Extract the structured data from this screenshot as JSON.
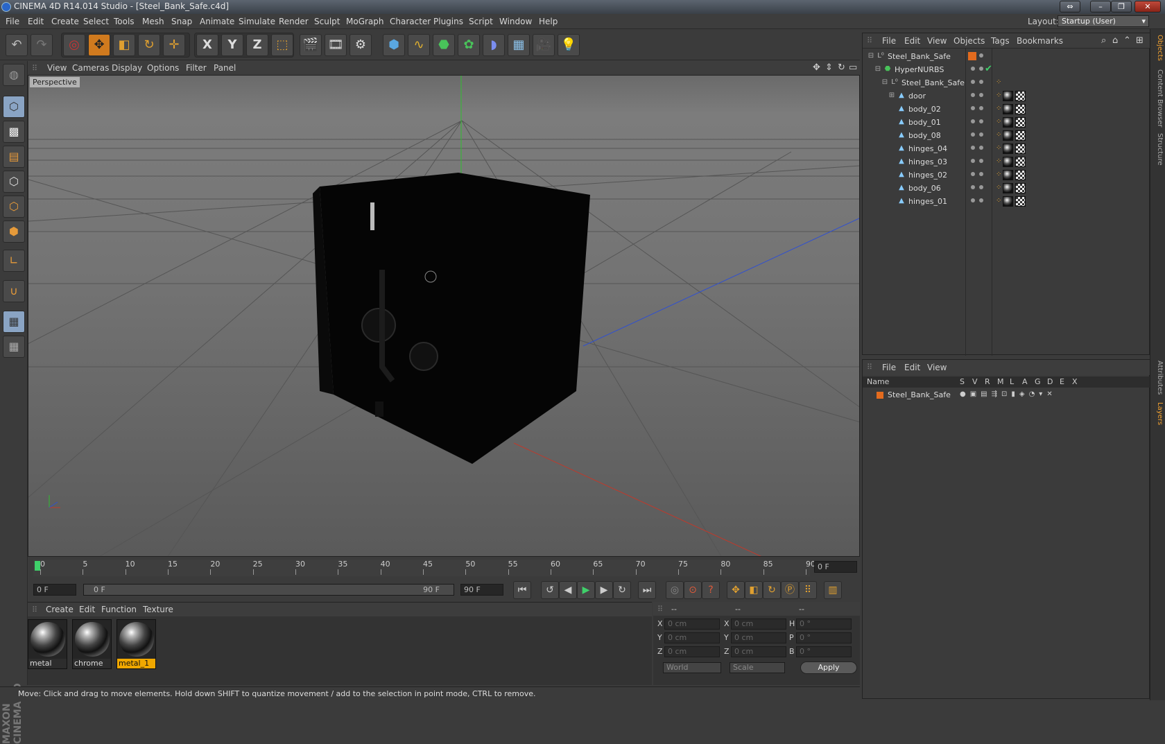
{
  "window": {
    "title": "CINEMA 4D R14.014 Studio - [Steel_Bank_Safe.c4d]"
  },
  "menubar": {
    "items": [
      "File",
      "Edit",
      "Create",
      "Select",
      "Tools",
      "Mesh",
      "Snap",
      "Animate",
      "Simulate",
      "Render",
      "Sculpt",
      "MoGraph",
      "Character",
      "Plugins",
      "Script",
      "Window",
      "Help"
    ],
    "layout_label": "Layout:",
    "layout_value": "Startup (User)"
  },
  "toolbar": {
    "x_label": "X",
    "y_label": "Y",
    "z_label": "Z"
  },
  "viewport": {
    "menu": [
      "View",
      "Cameras",
      "Display",
      "Options",
      "Filter",
      "Panel"
    ],
    "label": "Perspective"
  },
  "timeline": {
    "ticks": [
      "0",
      "5",
      "10",
      "15",
      "20",
      "25",
      "30",
      "35",
      "40",
      "45",
      "50",
      "55",
      "60",
      "65",
      "70",
      "75",
      "80",
      "85",
      "90"
    ],
    "current_frame": "0 F"
  },
  "transport": {
    "start": "0 F",
    "range_start": "0 F",
    "range_end": "90 F",
    "end": "90 F"
  },
  "material_panel": {
    "menu": [
      "Create",
      "Edit",
      "Function",
      "Texture"
    ],
    "materials": [
      "metal",
      "chrome",
      "metal_1"
    ]
  },
  "coords": {
    "headers": [
      "--",
      "--",
      "--"
    ],
    "rows": [
      {
        "a": "X",
        "av": "0 cm",
        "b": "X",
        "bv": "0 cm",
        "c": "H",
        "cv": "0 °"
      },
      {
        "a": "Y",
        "av": "0 cm",
        "b": "Y",
        "bv": "0 cm",
        "c": "P",
        "cv": "0 °"
      },
      {
        "a": "Z",
        "av": "0 cm",
        "b": "Z",
        "bv": "0 cm",
        "c": "B",
        "cv": "0 °"
      }
    ],
    "world": "World",
    "scale": "Scale",
    "apply": "Apply"
  },
  "status": "Move: Click and drag to move elements. Hold down SHIFT to quantize movement / add to the selection in point mode, CTRL to remove.",
  "object_manager": {
    "menu": [
      "File",
      "Edit",
      "View",
      "Objects",
      "Tags",
      "Bookmarks"
    ],
    "objects": [
      "Steel_Bank_Safe",
      "HyperNURBS",
      "Steel_Bank_Safe",
      "door",
      "body_02",
      "body_01",
      "body_08",
      "hinges_04",
      "hinges_03",
      "hinges_02",
      "body_06",
      "hinges_01"
    ]
  },
  "layer_manager": {
    "menu": [
      "File",
      "Edit",
      "View"
    ],
    "headers": [
      "Name",
      "S",
      "V",
      "R",
      "M",
      "L",
      "A",
      "G",
      "D",
      "E",
      "X"
    ],
    "layers": [
      "Steel_Bank_Safe"
    ]
  },
  "side_tabs": [
    "Objects",
    "Content Browser",
    "Structure",
    "Attributes",
    "Layers"
  ],
  "branding": "MAXON CINEMA 4D",
  "colors": {
    "accent": "#f0a800",
    "selected_tool": "#d07a1e"
  }
}
